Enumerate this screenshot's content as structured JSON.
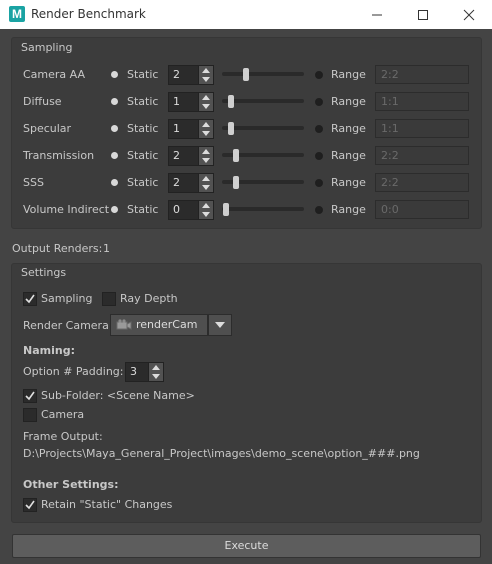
{
  "window": {
    "title": "Render Benchmark",
    "icon_letter": "M",
    "minimize_icon": "minimize-icon",
    "maximize_icon": "maximize-icon",
    "close_icon": "close-icon"
  },
  "sampling": {
    "title": "Sampling",
    "static_label": "Static",
    "range_label": "Range",
    "rows": [
      {
        "label": "Camera AA",
        "static_value": "2",
        "range_value": "2:2",
        "mode": "Static"
      },
      {
        "label": "Diffuse",
        "static_value": "1",
        "range_value": "1:1",
        "mode": "Static"
      },
      {
        "label": "Specular",
        "static_value": "1",
        "range_value": "1:1",
        "mode": "Static"
      },
      {
        "label": "Transmission",
        "static_value": "2",
        "range_value": "2:2",
        "mode": "Static"
      },
      {
        "label": "SSS",
        "static_value": "2",
        "range_value": "2:2",
        "mode": "Static"
      },
      {
        "label": "Volume Indirect",
        "static_value": "0",
        "range_value": "0:0",
        "mode": "Static"
      }
    ]
  },
  "output": {
    "label": "Output Renders:",
    "value": "1"
  },
  "settings": {
    "title": "Settings",
    "sampling_checkbox": {
      "label": "Sampling",
      "checked": true
    },
    "ray_depth_checkbox": {
      "label": "Ray Depth",
      "checked": false
    },
    "render_camera_label": "Render Camera:",
    "render_camera_value": "renderCam",
    "naming_label": "Naming:",
    "padding_label": "Option # Padding:",
    "padding_value": "3",
    "subfolder_checkbox": {
      "label": "Sub-Folder: <Scene Name>",
      "checked": true
    },
    "camera_checkbox": {
      "label": "Camera",
      "checked": false
    },
    "frame_output_label": "Frame Output:",
    "frame_output_path": "D:\\Projects\\Maya_General_Project\\images\\demo_scene\\option_###.png",
    "other_settings_label": "Other Settings:",
    "retain_checkbox": {
      "label": "Retain \"Static\" Changes",
      "checked": true
    }
  },
  "execute_label": "Execute",
  "colors": {
    "background": "#444444",
    "group": "#3c3c3c",
    "field": "#2b2b2b",
    "button": "#5d5d5d",
    "app_icon": "#1aa3a3"
  }
}
